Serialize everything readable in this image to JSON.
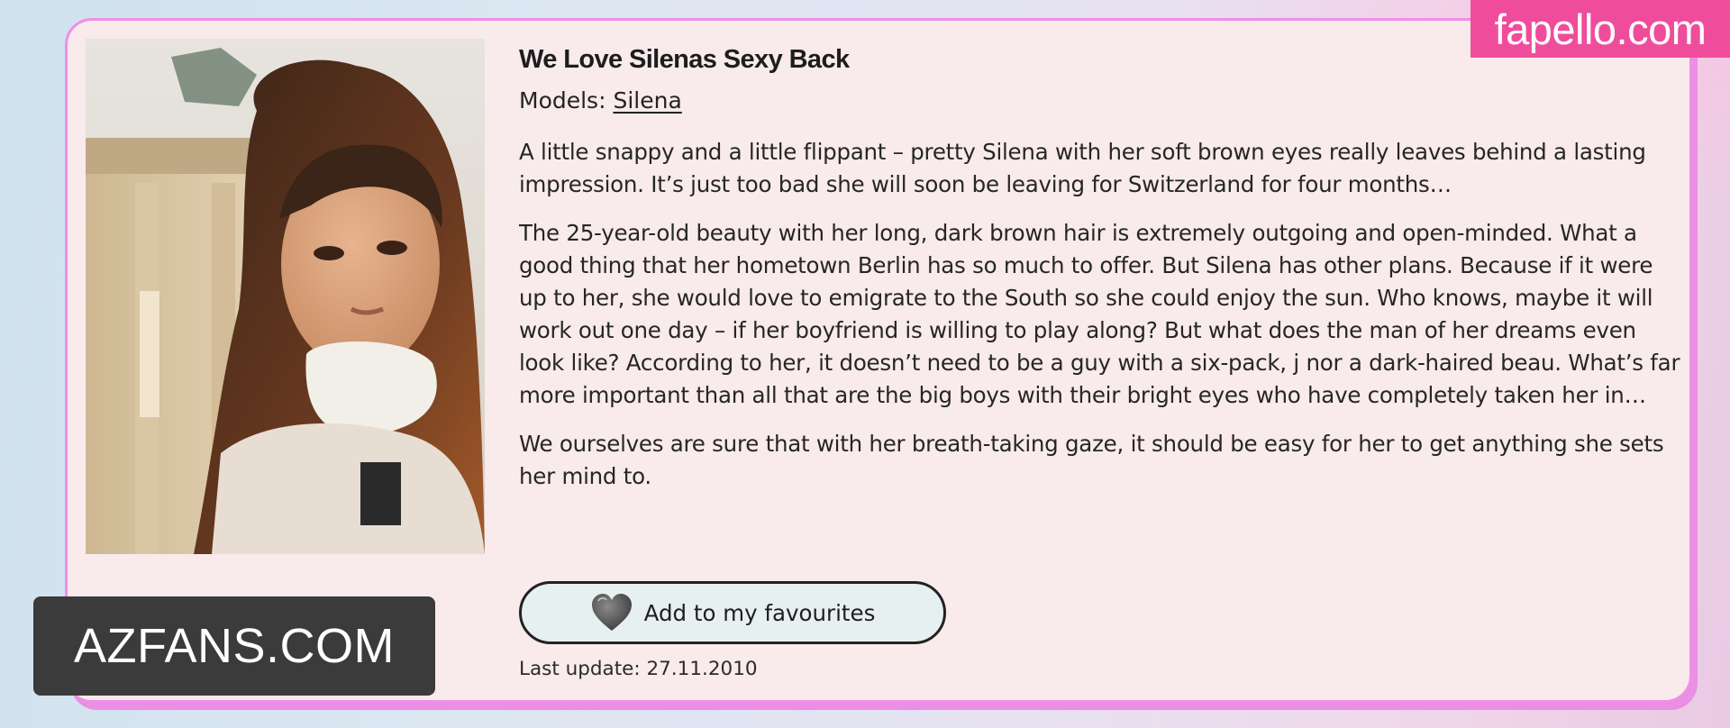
{
  "entry": {
    "title": "We Love Silenas Sexy Back",
    "models_label": "Models:",
    "models": [
      "Silena"
    ],
    "paragraphs": [
      "A little snappy and a little flippant – pretty Silena with her soft brown eyes really leaves behind a lasting impression. It’s just too bad she will soon be leaving for Switzerland for four months…",
      "The 25-year-old beauty with her long, dark brown hair is extremely outgoing and open-minded. What a good thing that her hometown Berlin has so much to offer. But Silena has other plans. Because if it were up to her, she would love to emigrate to the South so she could enjoy the sun. Who knows, maybe it will work out one day – if her boyfriend is willing to play along? But what does the man of her dreams even look like? According to her, it doesn’t need to be a guy with a six-pack, j nor a dark-haired beau. What’s far more important than all that are the big boys with their bright eyes who have completely taken her in…",
      "We ourselves are sure that with her breath-taking gaze, it should be easy for her to get anything she sets her mind to."
    ],
    "favourite_button": {
      "label": "Add to my favourites",
      "icon": "heart-icon"
    },
    "last_update": "Last update: 27.11.2010"
  },
  "watermarks": {
    "top_right": "fapello.com",
    "bottom_left": "AZFANS.COM"
  },
  "colors": {
    "card_background": "#f9eaec",
    "card_border": "#ee8fe8",
    "button_background": "#e6f0f0",
    "watermark_pink": "#ef4d9c",
    "watermark_dark": "#3b3b3b"
  }
}
